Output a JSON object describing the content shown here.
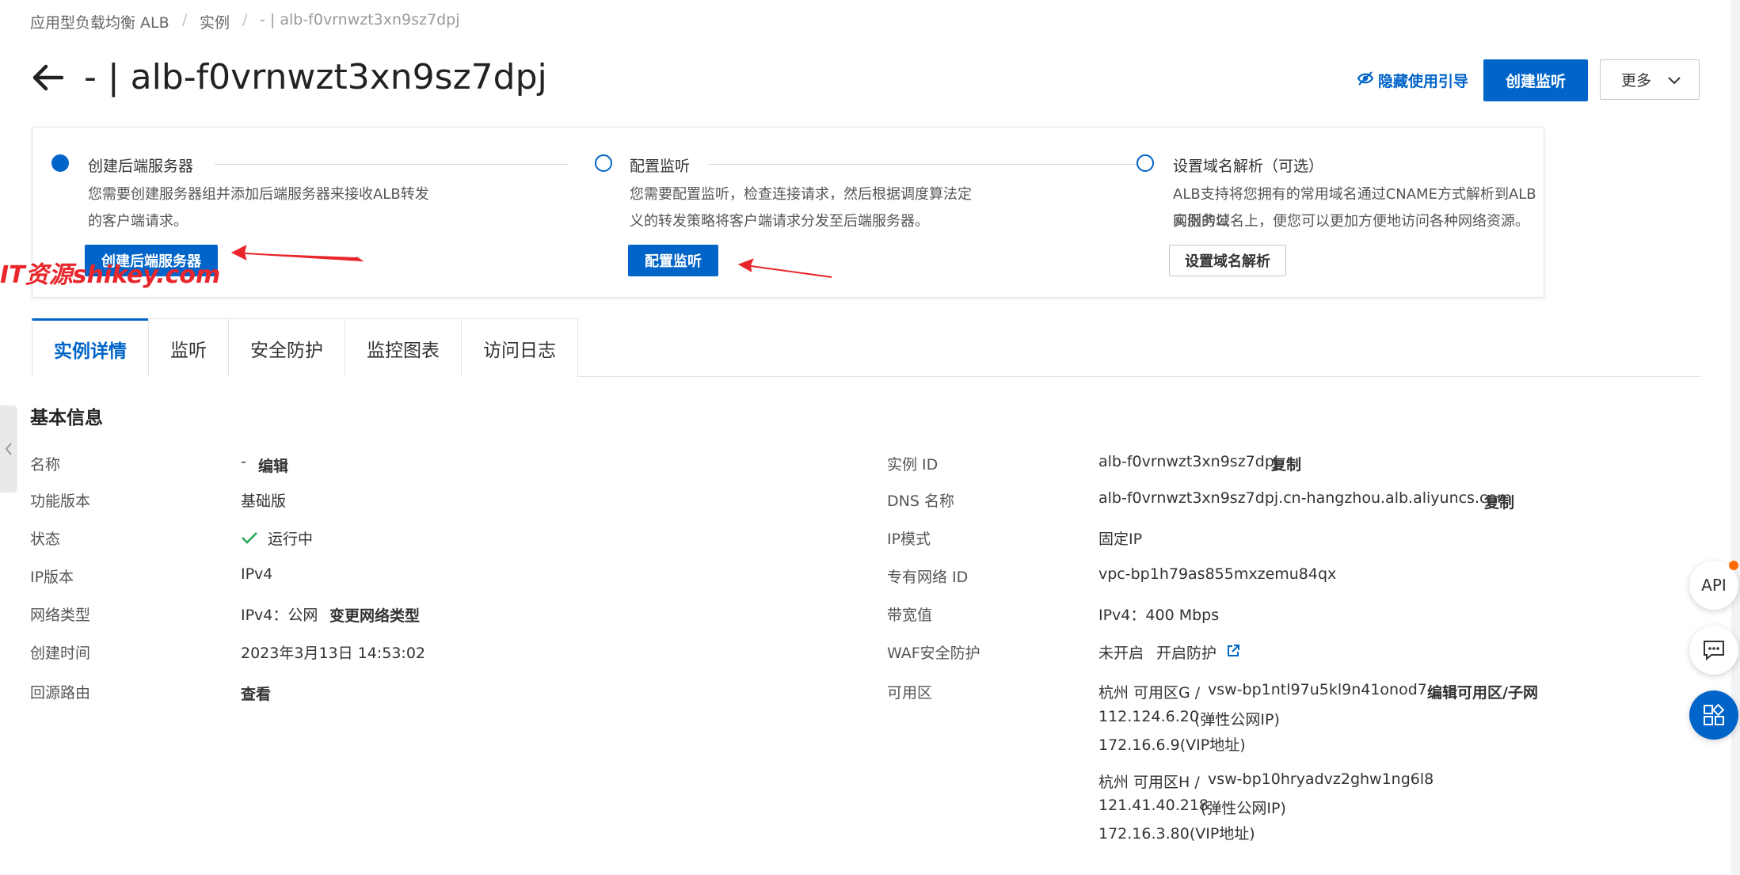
{
  "breadcrumb": {
    "items": [
      "应用型负载均衡 ALB",
      "实例",
      "- | alb-f0vrnwzt3xn9sz7dpj"
    ],
    "sep": "/"
  },
  "header": {
    "title": "- | alb-f0vrnwzt3xn9sz7dpj",
    "hide_guide_label": "隐藏使用引导",
    "create_listener_label": "创建监听",
    "more_label": "更多"
  },
  "steps": [
    {
      "title": "创建后端服务器",
      "desc_line1": "您需要创建服务器组并添加后端服务器来接收ALB转发",
      "desc_line2": "的客户端请求。",
      "button": "创建后端服务器"
    },
    {
      "title": "配置监听",
      "desc_line1": "您需要配置监听，检查连接请求，然后根据调度算法定",
      "desc_line2": "义的转发策略将客户端请求分发至后端服务器。",
      "button": "配置监听"
    },
    {
      "title": "设置域名解析（可选）",
      "desc_line1": "ALB支持将您拥有的常用域名通过CNAME方式解析到ALB实例的公",
      "desc_line2": "网服务域名上，便您可以更加方便地访问各种网络资源。",
      "button": "设置域名解析"
    }
  ],
  "watermark": "IT资源shikey.com",
  "tabs": [
    "实例详情",
    "监听",
    "安全防护",
    "监控图表",
    "访问日志"
  ],
  "section_title": "基本信息",
  "left_info": {
    "name_label": "名称",
    "name_value": "-",
    "name_edit": "编辑",
    "version_label": "功能版本",
    "version_value": "基础版",
    "status_label": "状态",
    "status_value": "运行中",
    "ipver_label": "IP版本",
    "ipver_value": "IPv4",
    "nettype_label": "网络类型",
    "nettype_value": "IPv4：公网",
    "nettype_change": "变更网络类型",
    "ctime_label": "创建时间",
    "ctime_value": "2023年3月13日 14:53:02",
    "route_label": "回源路由",
    "route_view": "查看"
  },
  "right_info": {
    "id_label": "实例 ID",
    "id_value": "alb-f0vrnwzt3xn9sz7dpj",
    "id_copy": "复制",
    "dns_label": "DNS 名称",
    "dns_value": "alb-f0vrnwzt3xn9sz7dpj.cn-hangzhou.alb.aliyuncs.com",
    "dns_copy": "复制",
    "ipmode_label": "IP模式",
    "ipmode_value": "固定IP",
    "vpc_label": "专有网络 ID",
    "vpc_value": "vpc-bp1h79as855mxzemu84qx",
    "bw_label": "带宽值",
    "bw_value": "IPv4：400 Mbps",
    "waf_label": "WAF安全防护",
    "waf_value": "未开启",
    "waf_enable": "开启防护",
    "zone_label": "可用区",
    "zone_g_prefix": "杭州 可用区G /",
    "zone_g_vsw": "vsw-bp1ntl97u5kl9n41onod7",
    "zone_edit": "编辑可用区/子网",
    "zone_g_eip": "112.124.6.20",
    "zone_g_eip_note": "(弹性公网IP)",
    "zone_g_vip": "172.16.6.9(VIP地址)",
    "zone_h_prefix": "杭州 可用区H /",
    "zone_h_vsw": "vsw-bp10hryadvz2ghw1ng6l8",
    "zone_h_eip": "121.41.40.218",
    "zone_h_eip_note": "(弹性公网IP)",
    "zone_h_vip": "172.16.3.80(VIP地址)"
  },
  "float": {
    "api_label": "API"
  },
  "colors": {
    "primary": "#0064c8",
    "success": "#23a45a",
    "annotation": "#e8262b"
  }
}
